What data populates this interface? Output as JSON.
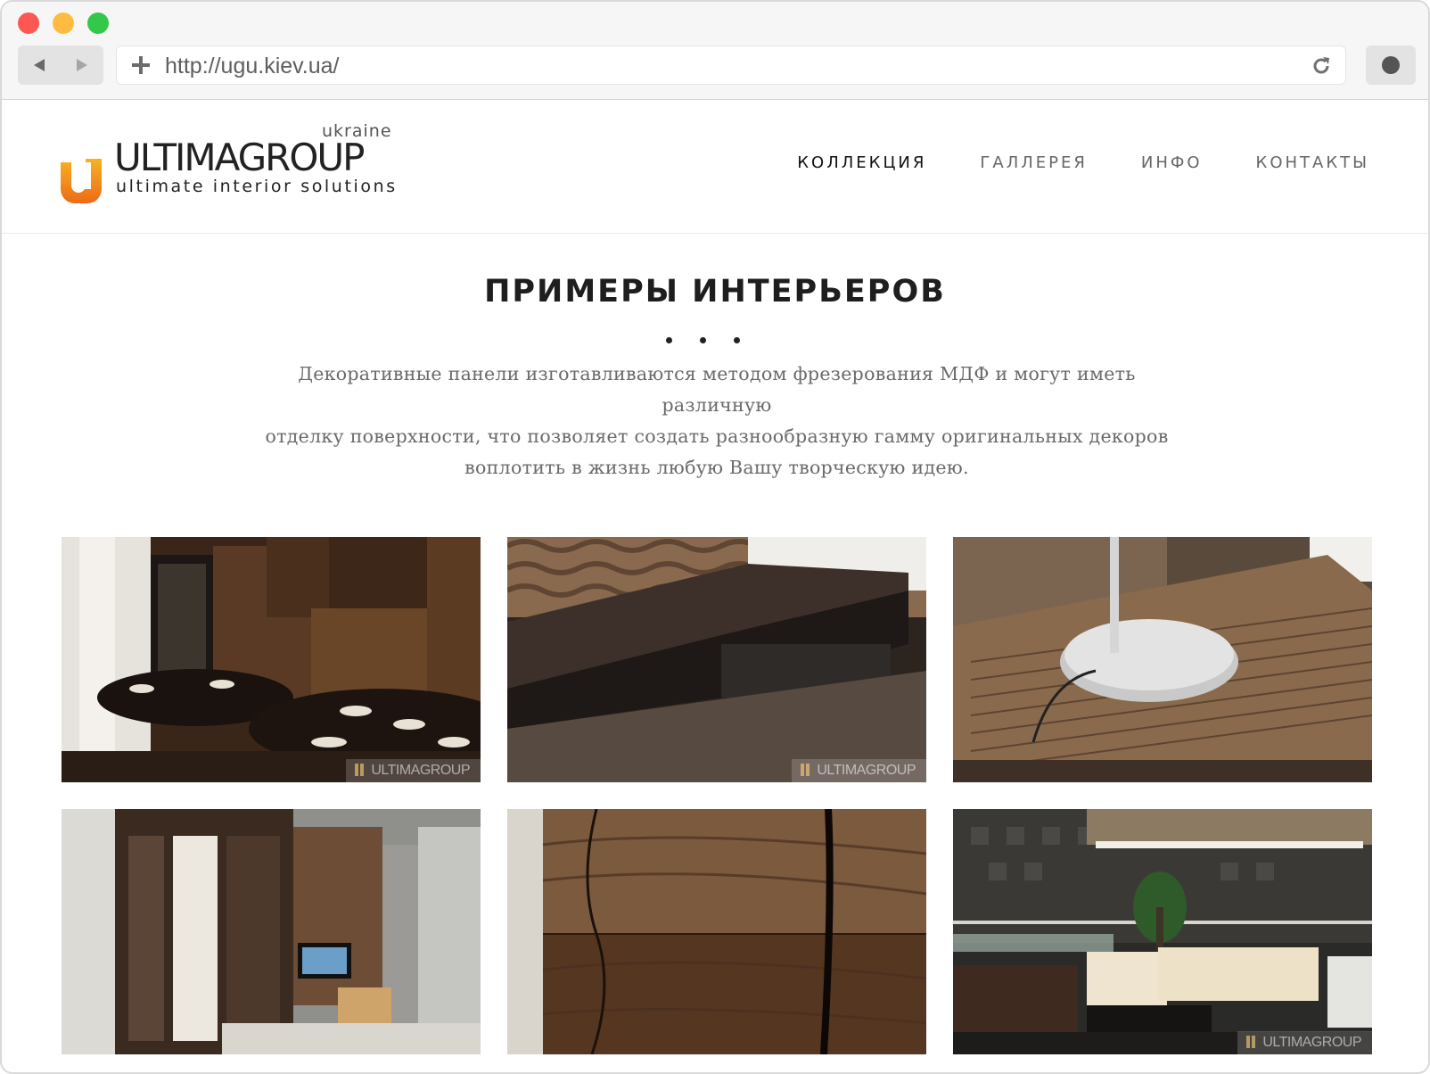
{
  "browser": {
    "url": "http://ugu.kiev.ua/",
    "icons": {
      "back": "back-arrow-icon",
      "forward": "forward-arrow-icon",
      "new_tab": "plus-icon",
      "reload": "reload-icon",
      "record": "record-icon"
    }
  },
  "logo": {
    "region": "ukraine",
    "name": "ULTIMAGROUP",
    "tagline": "ultimate interior solutions",
    "accent_color": "#f08a1c"
  },
  "nav": {
    "items": [
      {
        "label": "КОЛЛЕКЦИЯ",
        "active": true
      },
      {
        "label": "ГАЛЛЕРЕЯ",
        "active": false
      },
      {
        "label": "ИНФО",
        "active": false
      },
      {
        "label": "КОНТАКТЫ",
        "active": false
      }
    ]
  },
  "section": {
    "title": "ПРИМЕРЫ ИНТЕРЬЕРОВ",
    "description_lines": [
      "Декоративные панели изготавливаются методом фрезерования МДФ и могут иметь различную",
      "отделку поверхности, что позволяет создать разнообразную гамму оригинальных декоров",
      "воплотить в жизнь любую Вашу творческую идею."
    ]
  },
  "gallery": {
    "watermark": "ULTIMAGROUP",
    "items": [
      {
        "subject": "dining room with carved wood wall panels",
        "has_watermark": true
      },
      {
        "subject": "dark wood platform with wave-textured panel",
        "has_watermark": true
      },
      {
        "subject": "white lamp base on ribbed wood surface",
        "has_watermark": false
      },
      {
        "subject": "bedroom wardrobe with TV and fireplace",
        "has_watermark": false
      },
      {
        "subject": "walnut veneer wall panels close-up",
        "has_watermark": false
      },
      {
        "subject": "lounge with cream sofas and textured black wall",
        "has_watermark": true
      }
    ]
  }
}
